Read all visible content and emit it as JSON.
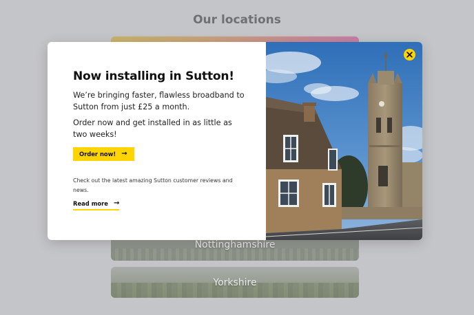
{
  "page": {
    "heading": "Our locations",
    "cards": [
      {
        "label": ""
      },
      {
        "label": "Nottinghamshire"
      },
      {
        "label": "Yorkshire"
      }
    ]
  },
  "modal": {
    "title": "Now installing in Sutton!",
    "paragraph_1": "We’re bringing faster, flawless broadband to Sutton from just £25 a month.",
    "paragraph_2": "Order now and get installed in as little as two weeks!",
    "order_button": "Order now!",
    "reviews_text": "Check out the latest amazing Sutton customer reviews and news.",
    "read_more": "Read more",
    "close_icon": "close-icon",
    "image": "church-street-photo"
  },
  "colors": {
    "accent": "#ffd400",
    "overlay_background": "#c4c5c8",
    "modal_background": "#ffffff"
  }
}
